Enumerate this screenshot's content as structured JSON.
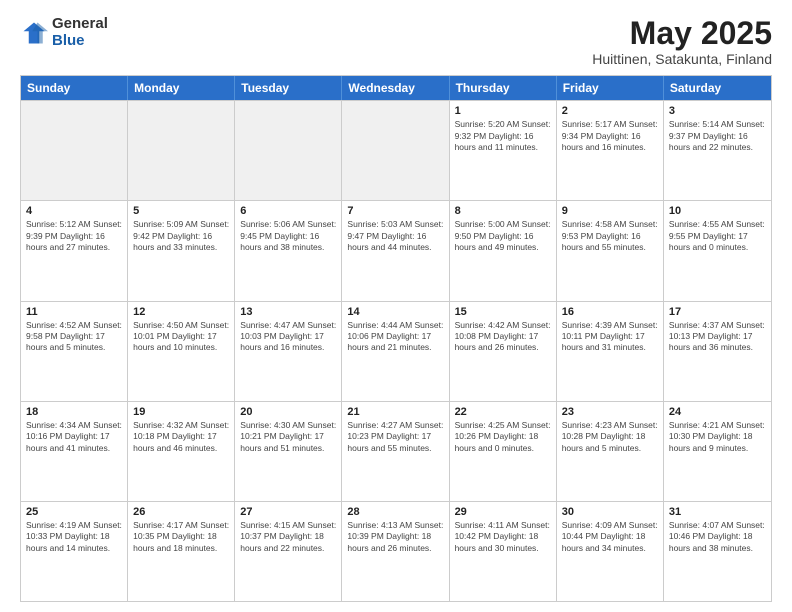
{
  "logo": {
    "general": "General",
    "blue": "Blue"
  },
  "title": "May 2025",
  "subtitle": "Huittinen, Satakunta, Finland",
  "header_days": [
    "Sunday",
    "Monday",
    "Tuesday",
    "Wednesday",
    "Thursday",
    "Friday",
    "Saturday"
  ],
  "weeks": [
    [
      {
        "day": "",
        "info": "",
        "empty": true
      },
      {
        "day": "",
        "info": "",
        "empty": true
      },
      {
        "day": "",
        "info": "",
        "empty": true
      },
      {
        "day": "",
        "info": "",
        "empty": true
      },
      {
        "day": "1",
        "info": "Sunrise: 5:20 AM\nSunset: 9:32 PM\nDaylight: 16 hours\nand 11 minutes."
      },
      {
        "day": "2",
        "info": "Sunrise: 5:17 AM\nSunset: 9:34 PM\nDaylight: 16 hours\nand 16 minutes."
      },
      {
        "day": "3",
        "info": "Sunrise: 5:14 AM\nSunset: 9:37 PM\nDaylight: 16 hours\nand 22 minutes."
      }
    ],
    [
      {
        "day": "4",
        "info": "Sunrise: 5:12 AM\nSunset: 9:39 PM\nDaylight: 16 hours\nand 27 minutes."
      },
      {
        "day": "5",
        "info": "Sunrise: 5:09 AM\nSunset: 9:42 PM\nDaylight: 16 hours\nand 33 minutes."
      },
      {
        "day": "6",
        "info": "Sunrise: 5:06 AM\nSunset: 9:45 PM\nDaylight: 16 hours\nand 38 minutes."
      },
      {
        "day": "7",
        "info": "Sunrise: 5:03 AM\nSunset: 9:47 PM\nDaylight: 16 hours\nand 44 minutes."
      },
      {
        "day": "8",
        "info": "Sunrise: 5:00 AM\nSunset: 9:50 PM\nDaylight: 16 hours\nand 49 minutes."
      },
      {
        "day": "9",
        "info": "Sunrise: 4:58 AM\nSunset: 9:53 PM\nDaylight: 16 hours\nand 55 minutes."
      },
      {
        "day": "10",
        "info": "Sunrise: 4:55 AM\nSunset: 9:55 PM\nDaylight: 17 hours\nand 0 minutes."
      }
    ],
    [
      {
        "day": "11",
        "info": "Sunrise: 4:52 AM\nSunset: 9:58 PM\nDaylight: 17 hours\nand 5 minutes."
      },
      {
        "day": "12",
        "info": "Sunrise: 4:50 AM\nSunset: 10:01 PM\nDaylight: 17 hours\nand 10 minutes."
      },
      {
        "day": "13",
        "info": "Sunrise: 4:47 AM\nSunset: 10:03 PM\nDaylight: 17 hours\nand 16 minutes."
      },
      {
        "day": "14",
        "info": "Sunrise: 4:44 AM\nSunset: 10:06 PM\nDaylight: 17 hours\nand 21 minutes."
      },
      {
        "day": "15",
        "info": "Sunrise: 4:42 AM\nSunset: 10:08 PM\nDaylight: 17 hours\nand 26 minutes."
      },
      {
        "day": "16",
        "info": "Sunrise: 4:39 AM\nSunset: 10:11 PM\nDaylight: 17 hours\nand 31 minutes."
      },
      {
        "day": "17",
        "info": "Sunrise: 4:37 AM\nSunset: 10:13 PM\nDaylight: 17 hours\nand 36 minutes."
      }
    ],
    [
      {
        "day": "18",
        "info": "Sunrise: 4:34 AM\nSunset: 10:16 PM\nDaylight: 17 hours\nand 41 minutes."
      },
      {
        "day": "19",
        "info": "Sunrise: 4:32 AM\nSunset: 10:18 PM\nDaylight: 17 hours\nand 46 minutes."
      },
      {
        "day": "20",
        "info": "Sunrise: 4:30 AM\nSunset: 10:21 PM\nDaylight: 17 hours\nand 51 minutes."
      },
      {
        "day": "21",
        "info": "Sunrise: 4:27 AM\nSunset: 10:23 PM\nDaylight: 17 hours\nand 55 minutes."
      },
      {
        "day": "22",
        "info": "Sunrise: 4:25 AM\nSunset: 10:26 PM\nDaylight: 18 hours\nand 0 minutes."
      },
      {
        "day": "23",
        "info": "Sunrise: 4:23 AM\nSunset: 10:28 PM\nDaylight: 18 hours\nand 5 minutes."
      },
      {
        "day": "24",
        "info": "Sunrise: 4:21 AM\nSunset: 10:30 PM\nDaylight: 18 hours\nand 9 minutes."
      }
    ],
    [
      {
        "day": "25",
        "info": "Sunrise: 4:19 AM\nSunset: 10:33 PM\nDaylight: 18 hours\nand 14 minutes."
      },
      {
        "day": "26",
        "info": "Sunrise: 4:17 AM\nSunset: 10:35 PM\nDaylight: 18 hours\nand 18 minutes."
      },
      {
        "day": "27",
        "info": "Sunrise: 4:15 AM\nSunset: 10:37 PM\nDaylight: 18 hours\nand 22 minutes."
      },
      {
        "day": "28",
        "info": "Sunrise: 4:13 AM\nSunset: 10:39 PM\nDaylight: 18 hours\nand 26 minutes."
      },
      {
        "day": "29",
        "info": "Sunrise: 4:11 AM\nSunset: 10:42 PM\nDaylight: 18 hours\nand 30 minutes."
      },
      {
        "day": "30",
        "info": "Sunrise: 4:09 AM\nSunset: 10:44 PM\nDaylight: 18 hours\nand 34 minutes."
      },
      {
        "day": "31",
        "info": "Sunrise: 4:07 AM\nSunset: 10:46 PM\nDaylight: 18 hours\nand 38 minutes."
      }
    ]
  ]
}
